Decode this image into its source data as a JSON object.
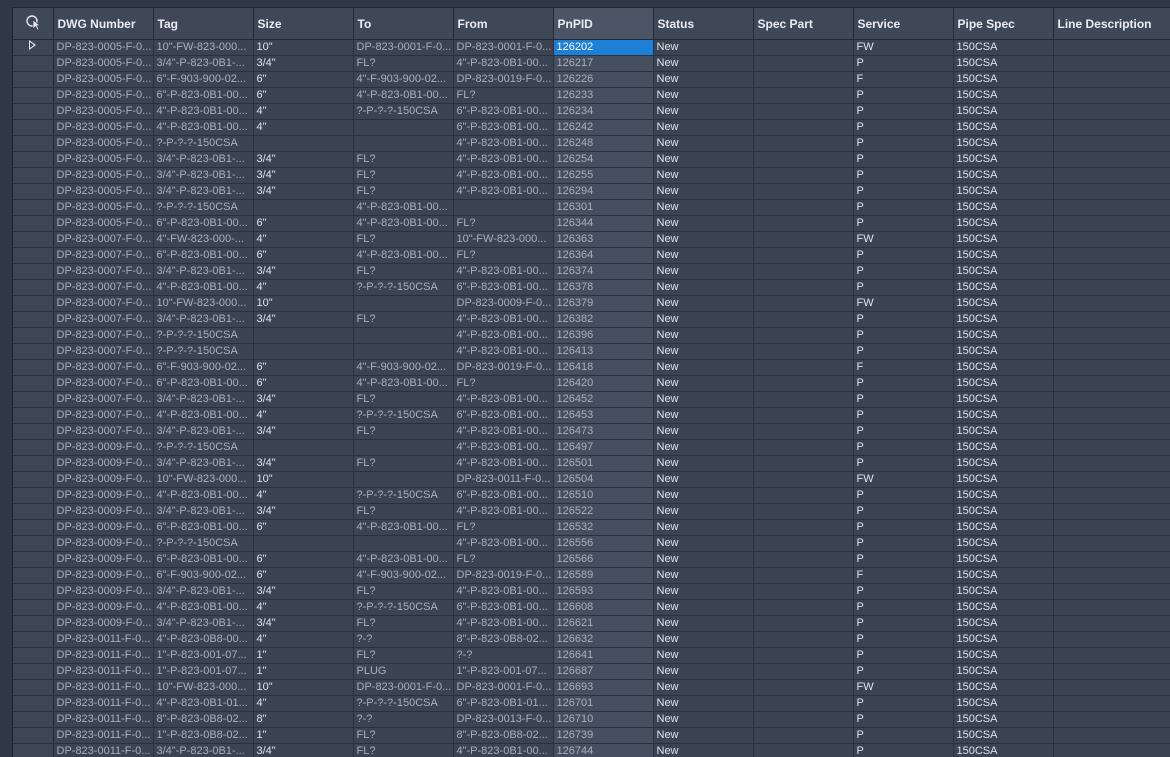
{
  "grid": {
    "columns": [
      "DWG Number",
      "Tag",
      "Size",
      "To",
      "From",
      "PnPID",
      "Status",
      "Spec Part",
      "Service",
      "Pipe Spec",
      "Line Description"
    ],
    "active_row": 0,
    "rows": [
      [
        "DP-823-0005-F-0...",
        "10\"-FW-823-000...",
        "10\"",
        "DP-823-0001-F-0...",
        "DP-823-0001-F-0...",
        "126202",
        "New",
        "",
        "FW",
        "150CSA",
        ""
      ],
      [
        "DP-823-0005-F-0...",
        "3/4\"-P-823-0B1-...",
        "3/4\"",
        "FL?",
        "4\"-P-823-0B1-00...",
        "126217",
        "New",
        "",
        "P",
        "150CSA",
        ""
      ],
      [
        "DP-823-0005-F-0...",
        "6\"-F-903-900-02...",
        "6\"",
        "4\"-F-903-900-02...",
        "DP-823-0019-F-0...",
        "126226",
        "New",
        "",
        "F",
        "150CSA",
        ""
      ],
      [
        "DP-823-0005-F-0...",
        "6\"-P-823-0B1-00...",
        "6\"",
        "4\"-P-823-0B1-00...",
        "FL?",
        "126233",
        "New",
        "",
        "P",
        "150CSA",
        ""
      ],
      [
        "DP-823-0005-F-0...",
        "4\"-P-823-0B1-00...",
        "4\"",
        "?-P-?-?-150CSA",
        "6\"-P-823-0B1-00...",
        "126234",
        "New",
        "",
        "P",
        "150CSA",
        ""
      ],
      [
        "DP-823-0005-F-0...",
        "4\"-P-823-0B1-00...",
        "4\"",
        "",
        "6\"-P-823-0B1-00...",
        "126242",
        "New",
        "",
        "P",
        "150CSA",
        ""
      ],
      [
        "DP-823-0005-F-0...",
        "?-P-?-?-150CSA",
        "",
        "",
        "4\"-P-823-0B1-00...",
        "126248",
        "New",
        "",
        "P",
        "150CSA",
        ""
      ],
      [
        "DP-823-0005-F-0...",
        "3/4\"-P-823-0B1-...",
        "3/4\"",
        "FL?",
        "4\"-P-823-0B1-00...",
        "126254",
        "New",
        "",
        "P",
        "150CSA",
        ""
      ],
      [
        "DP-823-0005-F-0...",
        "3/4\"-P-823-0B1-...",
        "3/4\"",
        "FL?",
        "4\"-P-823-0B1-00...",
        "126255",
        "New",
        "",
        "P",
        "150CSA",
        ""
      ],
      [
        "DP-823-0005-F-0...",
        "3/4\"-P-823-0B1-...",
        "3/4\"",
        "FL?",
        "4\"-P-823-0B1-00...",
        "126294",
        "New",
        "",
        "P",
        "150CSA",
        ""
      ],
      [
        "DP-823-0005-F-0...",
        "?-P-?-?-150CSA",
        "",
        "4\"-P-823-0B1-00...",
        "",
        "126301",
        "New",
        "",
        "P",
        "150CSA",
        ""
      ],
      [
        "DP-823-0005-F-0...",
        "6\"-P-823-0B1-00...",
        "6\"",
        "4\"-P-823-0B1-00...",
        "FL?",
        "126344",
        "New",
        "",
        "P",
        "150CSA",
        ""
      ],
      [
        "DP-823-0007-F-0...",
        "4\"-FW-823-000-...",
        "4\"",
        "FL?",
        "10\"-FW-823-000...",
        "126363",
        "New",
        "",
        "FW",
        "150CSA",
        ""
      ],
      [
        "DP-823-0007-F-0...",
        "6\"-P-823-0B1-00...",
        "6\"",
        "4\"-P-823-0B1-00...",
        "FL?",
        "126364",
        "New",
        "",
        "P",
        "150CSA",
        ""
      ],
      [
        "DP-823-0007-F-0...",
        "3/4\"-P-823-0B1-...",
        "3/4\"",
        "FL?",
        "4\"-P-823-0B1-00...",
        "126374",
        "New",
        "",
        "P",
        "150CSA",
        ""
      ],
      [
        "DP-823-0007-F-0...",
        "4\"-P-823-0B1-00...",
        "4\"",
        "?-P-?-?-150CSA",
        "6\"-P-823-0B1-00...",
        "126378",
        "New",
        "",
        "P",
        "150CSA",
        ""
      ],
      [
        "DP-823-0007-F-0...",
        "10\"-FW-823-000...",
        "10\"",
        "",
        "DP-823-0009-F-0...",
        "126379",
        "New",
        "",
        "FW",
        "150CSA",
        ""
      ],
      [
        "DP-823-0007-F-0...",
        "3/4\"-P-823-0B1-...",
        "3/4\"",
        "FL?",
        "4\"-P-823-0B1-00...",
        "126382",
        "New",
        "",
        "P",
        "150CSA",
        ""
      ],
      [
        "DP-823-0007-F-0...",
        "?-P-?-?-150CSA",
        "",
        "",
        "4\"-P-823-0B1-00...",
        "126396",
        "New",
        "",
        "P",
        "150CSA",
        ""
      ],
      [
        "DP-823-0007-F-0...",
        "?-P-?-?-150CSA",
        "",
        "",
        "4\"-P-823-0B1-00...",
        "126413",
        "New",
        "",
        "P",
        "150CSA",
        ""
      ],
      [
        "DP-823-0007-F-0...",
        "6\"-F-903-900-02...",
        "6\"",
        "4\"-F-903-900-02...",
        "DP-823-0019-F-0...",
        "126418",
        "New",
        "",
        "F",
        "150CSA",
        ""
      ],
      [
        "DP-823-0007-F-0...",
        "6\"-P-823-0B1-00...",
        "6\"",
        "4\"-P-823-0B1-00...",
        "FL?",
        "126420",
        "New",
        "",
        "P",
        "150CSA",
        ""
      ],
      [
        "DP-823-0007-F-0...",
        "3/4\"-P-823-0B1-...",
        "3/4\"",
        "FL?",
        "4\"-P-823-0B1-00...",
        "126452",
        "New",
        "",
        "P",
        "150CSA",
        ""
      ],
      [
        "DP-823-0007-F-0...",
        "4\"-P-823-0B1-00...",
        "4\"",
        "?-P-?-?-150CSA",
        "6\"-P-823-0B1-00...",
        "126453",
        "New",
        "",
        "P",
        "150CSA",
        ""
      ],
      [
        "DP-823-0007-F-0...",
        "3/4\"-P-823-0B1-...",
        "3/4\"",
        "FL?",
        "4\"-P-823-0B1-00...",
        "126473",
        "New",
        "",
        "P",
        "150CSA",
        ""
      ],
      [
        "DP-823-0009-F-0...",
        "?-P-?-?-150CSA",
        "",
        "",
        "4\"-P-823-0B1-00...",
        "126497",
        "New",
        "",
        "P",
        "150CSA",
        ""
      ],
      [
        "DP-823-0009-F-0...",
        "3/4\"-P-823-0B1-...",
        "3/4\"",
        "FL?",
        "4\"-P-823-0B1-00...",
        "126501",
        "New",
        "",
        "P",
        "150CSA",
        ""
      ],
      [
        "DP-823-0009-F-0...",
        "10\"-FW-823-000...",
        "10\"",
        "",
        "DP-823-0011-F-0...",
        "126504",
        "New",
        "",
        "FW",
        "150CSA",
        ""
      ],
      [
        "DP-823-0009-F-0...",
        "4\"-P-823-0B1-00...",
        "4\"",
        "?-P-?-?-150CSA",
        "6\"-P-823-0B1-00...",
        "126510",
        "New",
        "",
        "P",
        "150CSA",
        ""
      ],
      [
        "DP-823-0009-F-0...",
        "3/4\"-P-823-0B1-...",
        "3/4\"",
        "FL?",
        "4\"-P-823-0B1-00...",
        "126522",
        "New",
        "",
        "P",
        "150CSA",
        ""
      ],
      [
        "DP-823-0009-F-0...",
        "6\"-P-823-0B1-00...",
        "6\"",
        "4\"-P-823-0B1-00...",
        "FL?",
        "126532",
        "New",
        "",
        "P",
        "150CSA",
        ""
      ],
      [
        "DP-823-0009-F-0...",
        "?-P-?-?-150CSA",
        "",
        "",
        "4\"-P-823-0B1-00...",
        "126556",
        "New",
        "",
        "P",
        "150CSA",
        ""
      ],
      [
        "DP-823-0009-F-0...",
        "6\"-P-823-0B1-00...",
        "6\"",
        "4\"-P-823-0B1-00...",
        "FL?",
        "126566",
        "New",
        "",
        "P",
        "150CSA",
        ""
      ],
      [
        "DP-823-0009-F-0...",
        "6\"-F-903-900-02...",
        "6\"",
        "4\"-F-903-900-02...",
        "DP-823-0019-F-0...",
        "126589",
        "New",
        "",
        "F",
        "150CSA",
        ""
      ],
      [
        "DP-823-0009-F-0...",
        "3/4\"-P-823-0B1-...",
        "3/4\"",
        "FL?",
        "4\"-P-823-0B1-00...",
        "126593",
        "New",
        "",
        "P",
        "150CSA",
        ""
      ],
      [
        "DP-823-0009-F-0...",
        "4\"-P-823-0B1-00...",
        "4\"",
        "?-P-?-?-150CSA",
        "6\"-P-823-0B1-00...",
        "126608",
        "New",
        "",
        "P",
        "150CSA",
        ""
      ],
      [
        "DP-823-0009-F-0...",
        "3/4\"-P-823-0B1-...",
        "3/4\"",
        "FL?",
        "4\"-P-823-0B1-00...",
        "126621",
        "New",
        "",
        "P",
        "150CSA",
        ""
      ],
      [
        "DP-823-0011-F-0...",
        "4\"-P-823-0B8-00...",
        "4\"",
        "?-?",
        "8\"-P-823-0B8-02...",
        "126632",
        "New",
        "",
        "P",
        "150CSA",
        ""
      ],
      [
        "DP-823-0011-F-0...",
        "1\"-P-823-001-07...",
        "1\"",
        "FL?",
        "?-?",
        "126641",
        "New",
        "",
        "P",
        "150CSA",
        ""
      ],
      [
        "DP-823-0011-F-0...",
        "1\"-P-823-001-07...",
        "1\"",
        "PLUG",
        "1\"-P-823-001-07...",
        "126687",
        "New",
        "",
        "P",
        "150CSA",
        ""
      ],
      [
        "DP-823-0011-F-0...",
        "10\"-FW-823-000...",
        "10\"",
        "DP-823-0001-F-0...",
        "DP-823-0001-F-0...",
        "126693",
        "New",
        "",
        "FW",
        "150CSA",
        ""
      ],
      [
        "DP-823-0011-F-0...",
        "4\"-P-823-0B1-01...",
        "4\"",
        "?-P-?-?-150CSA",
        "6\"-P-823-0B1-01...",
        "126701",
        "New",
        "",
        "P",
        "150CSA",
        ""
      ],
      [
        "DP-823-0011-F-0...",
        "8\"-P-823-0B8-02...",
        "8\"",
        "?-?",
        "DP-823-0013-F-0...",
        "126710",
        "New",
        "",
        "P",
        "150CSA",
        ""
      ],
      [
        "DP-823-0011-F-0...",
        "1\"-P-823-0B8-02...",
        "1\"",
        "FL?",
        "8\"-P-823-0B8-02...",
        "126739",
        "New",
        "",
        "P",
        "150CSA",
        ""
      ],
      [
        "DP-823-0011-F-0...",
        "3/4\"-P-823-0B1-...",
        "3/4\"",
        "FL?",
        "4\"-P-823-0B1-00...",
        "126744",
        "New",
        "",
        "P",
        "150CSA",
        ""
      ]
    ]
  }
}
